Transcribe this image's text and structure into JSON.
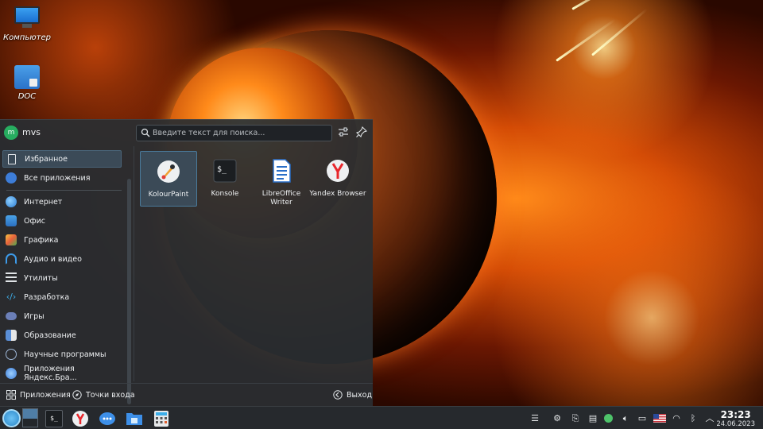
{
  "desktop": {
    "icons": [
      {
        "label": "Компьютер",
        "icon": "computer-icon"
      },
      {
        "label": "DOC",
        "icon": "folder-doc-icon"
      }
    ]
  },
  "launcher": {
    "user": {
      "name": "mvs",
      "avatar_letter": "m",
      "avatar_color": "#27ae60"
    },
    "search": {
      "placeholder": "Введите текст для поиска..."
    },
    "categories": [
      {
        "label": "Избранное",
        "icon": "bookmark-icon",
        "selected": true
      },
      {
        "label": "Все приложения",
        "icon": "all-apps-icon"
      },
      {
        "label": "Интернет",
        "icon": "globe-icon"
      },
      {
        "label": "Офис",
        "icon": "office-icon"
      },
      {
        "label": "Графика",
        "icon": "graphics-icon"
      },
      {
        "label": "Аудио и видео",
        "icon": "headphones-icon"
      },
      {
        "label": "Утилиты",
        "icon": "utilities-icon"
      },
      {
        "label": "Разработка",
        "icon": "code-icon"
      },
      {
        "label": "Игры",
        "icon": "gamepad-icon"
      },
      {
        "label": "Образование",
        "icon": "education-icon"
      },
      {
        "label": "Научные программы",
        "icon": "atom-icon"
      },
      {
        "label": "Приложения Яндекс.Бра...",
        "icon": "yandex-apps-icon"
      }
    ],
    "favorites": [
      {
        "label": "KolourPaint",
        "icon": "kolourpaint-icon",
        "selected": true
      },
      {
        "label": "Konsole",
        "icon": "konsole-icon"
      },
      {
        "label": "LibreOffice Writer",
        "icon": "libreoffice-writer-icon"
      },
      {
        "label": "Yandex Browser",
        "icon": "yandex-browser-icon"
      }
    ],
    "footer": {
      "apps_label": "Приложения",
      "places_label": "Точки входа",
      "leave_label": "Выход"
    }
  },
  "taskbar": {
    "tasks": [
      "app-launcher-icon",
      "pager-icon",
      "konsole-icon",
      "yandex-browser-icon",
      "messenger-icon",
      "file-manager-icon",
      "calculator-icon"
    ],
    "tray": [
      "settings-sliders-icon",
      "steam-icon",
      "network-share-icon",
      "clipboard-icon",
      "status-indicator-icon",
      "volume-icon",
      "display-icon",
      "us-flag-icon",
      "wifi-icon",
      "bluetooth-icon",
      "show-hidden-icon"
    ],
    "clock": {
      "time": "23:23",
      "date": "24.06.2023"
    }
  },
  "colors": {
    "accent": "#3daee9",
    "panel": "#2a2e32",
    "selection": "#3b4a57"
  }
}
